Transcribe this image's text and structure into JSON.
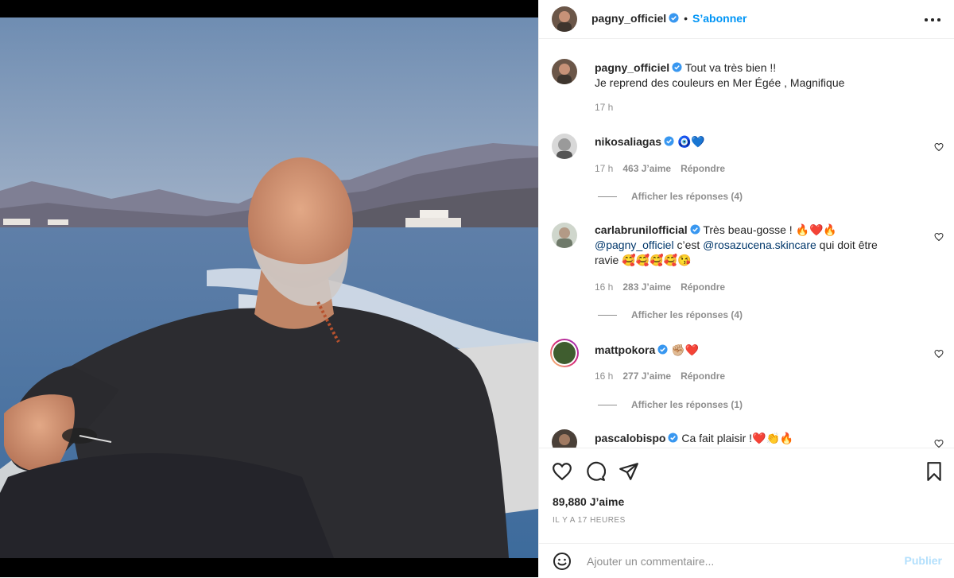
{
  "post": {
    "author": "pagny_officiel",
    "follow_label": "S’abonner",
    "caption_line1": "Tout va très bien !!",
    "caption_line2": "Je reprend des couleurs en Mer Égée , Magnifique",
    "caption_time": "17 h"
  },
  "comments": [
    {
      "user": "nikosaliagas",
      "text": "🧿💙",
      "time": "17 h",
      "likes": "463 J’aime",
      "reply": "Répondre",
      "view_replies": "Afficher les réponses (4)"
    },
    {
      "user": "carlabrunilofficial",
      "text_line1": "Très beau-gosse ! 🔥❤️🔥",
      "mention1": "@pagny_officiel",
      "text_mid": " c’est ",
      "mention2": "@rosazucena.skincare",
      "text_end": " qui doit être",
      "text_line3": "ravie 🥰🥰🥰🥰😘",
      "time": "16 h",
      "likes": "283 J’aime",
      "reply": "Répondre",
      "view_replies": "Afficher les réponses (4)"
    },
    {
      "user": "mattpokora",
      "text": "✊🏼❤️",
      "time": "16 h",
      "likes": "277 J’aime",
      "reply": "Répondre",
      "view_replies": "Afficher les réponses (1)"
    },
    {
      "user": "pascalobispo",
      "text": "Ca fait plaisir !❤️👏🔥"
    }
  ],
  "engagement": {
    "likes_count": "89,880 J’aime",
    "posted_ago": "IL Y A 17 HEURES"
  },
  "composer": {
    "placeholder": "Ajouter un commentaire...",
    "publish_label": "Publier"
  },
  "icons": {
    "verified": "verified-badge-icon",
    "like": "heart-icon",
    "comment": "comment-icon",
    "share": "paper-plane-icon",
    "save": "bookmark-icon",
    "emoji": "smiley-icon",
    "more": "more-options-icon"
  },
  "colors": {
    "accent": "#0095f6",
    "verified": "#3897f0",
    "publish_disabled": "#b2dffc",
    "muted": "#8e8e8e"
  }
}
